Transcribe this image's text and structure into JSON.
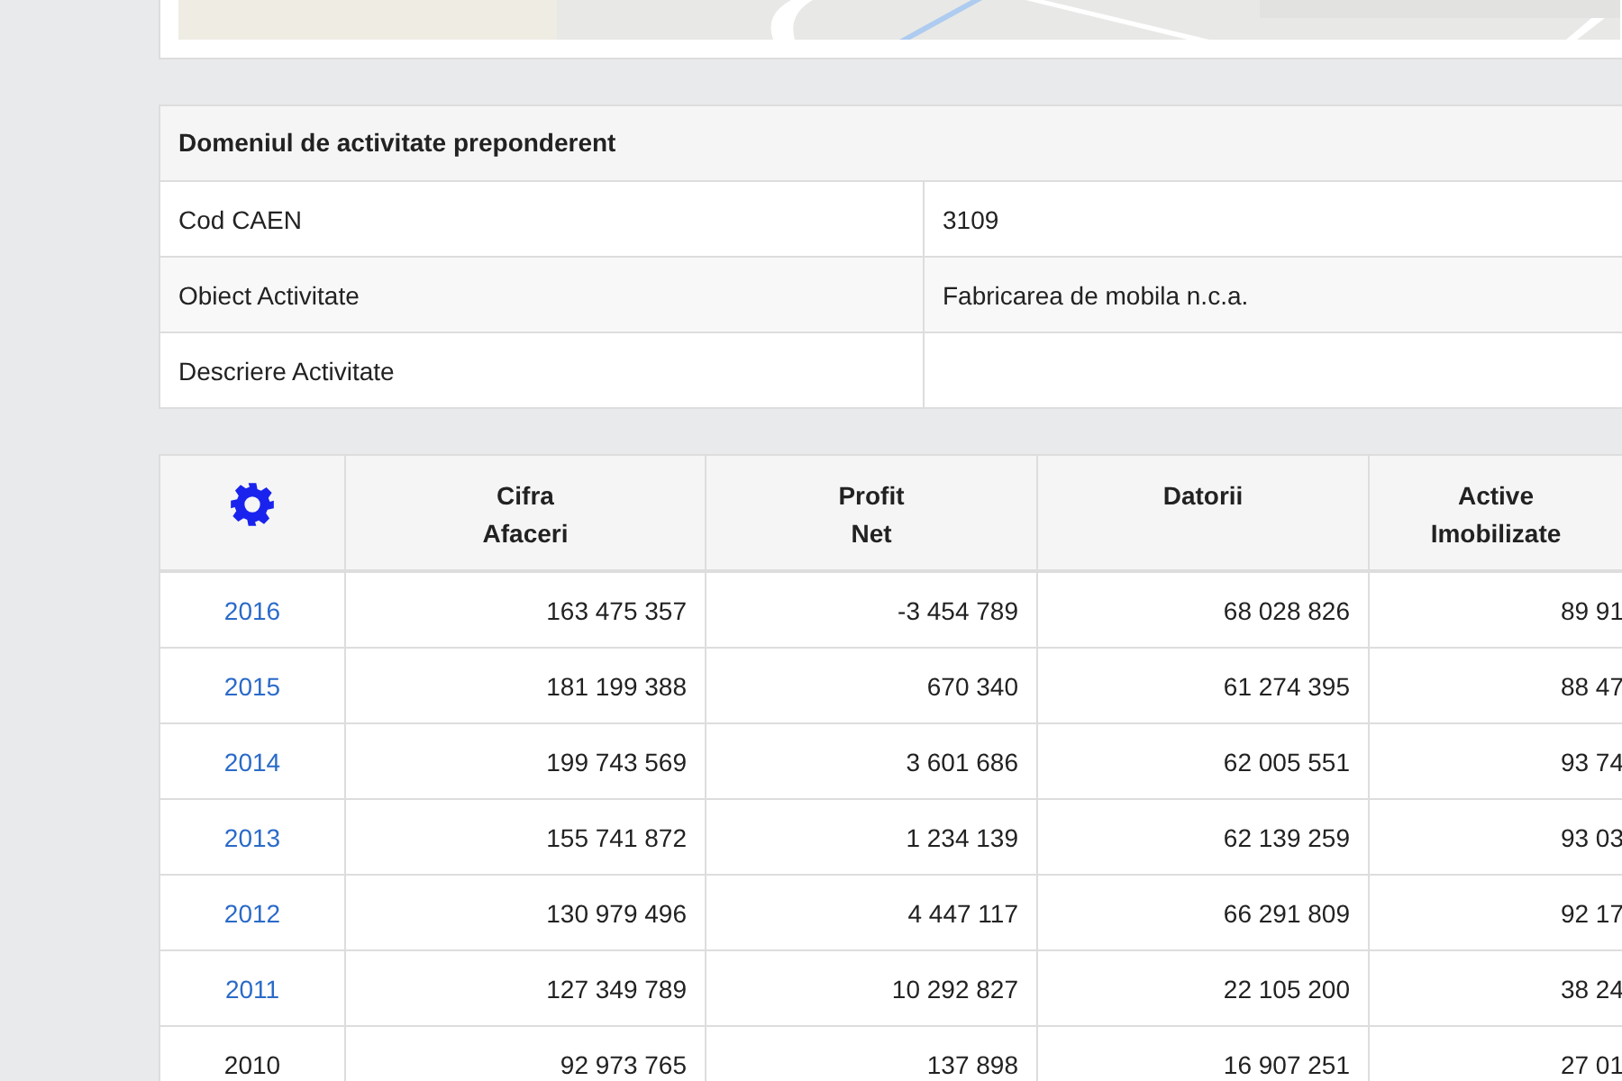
{
  "activity": {
    "title": "Domeniul de activitate preponderent",
    "rows": [
      {
        "label": "Cod CAEN",
        "value": "3109"
      },
      {
        "label": "Obiect Activitate",
        "value": "Fabricarea de mobila n.c.a."
      },
      {
        "label": "Descriere Activitate"
      }
    ]
  },
  "financials": {
    "columns": [
      "Cifra\nAfaceri",
      "Profit\nNet",
      "Datorii",
      "Active\nImobilizate"
    ],
    "rows": [
      {
        "year": "2016",
        "linked": true,
        "values": [
          "163 475 357",
          "-3 454 789",
          "68 028 826",
          "89 91"
        ]
      },
      {
        "year": "2015",
        "linked": true,
        "values": [
          "181 199 388",
          "670 340",
          "61 274 395",
          "88 47"
        ]
      },
      {
        "year": "2014",
        "linked": true,
        "values": [
          "199 743 569",
          "3 601 686",
          "62 005 551",
          "93 74"
        ]
      },
      {
        "year": "2013",
        "linked": true,
        "values": [
          "155 741 872",
          "1 234 139",
          "62 139 259",
          "93 03"
        ]
      },
      {
        "year": "2012",
        "linked": true,
        "values": [
          "130 979 496",
          "4 447 117",
          "66 291 809",
          "92 17"
        ]
      },
      {
        "year": "2011",
        "linked": true,
        "values": [
          "127 349 789",
          "10 292 827",
          "22 105 200",
          "38 24"
        ]
      },
      {
        "year": "2010",
        "linked": false,
        "values": [
          "92 973 765",
          "137 898",
          "16 907 251",
          "27 01"
        ]
      }
    ]
  }
}
